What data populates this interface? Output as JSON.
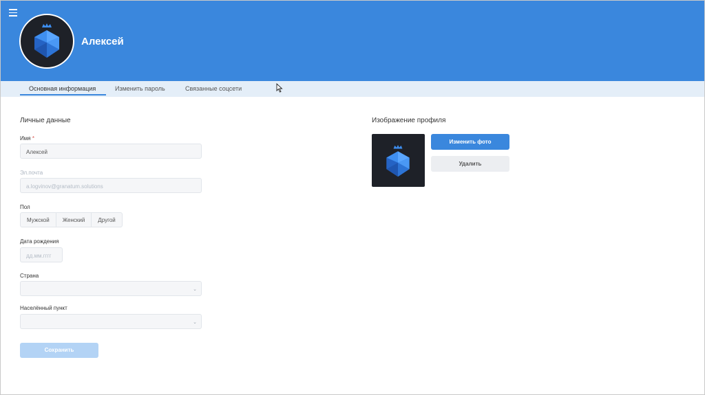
{
  "header": {
    "user_name": "Алексей",
    "background_color": "#3a87dd",
    "menu_icon": "hamburger-menu-icon",
    "avatar_icon": "crowned-gem-icon"
  },
  "tabs": [
    {
      "label": "Основная информация",
      "active": true
    },
    {
      "label": "Изменить пароль",
      "active": false
    },
    {
      "label": "Связанные соцсети",
      "active": false
    }
  ],
  "personal": {
    "section_title": "Личные данные",
    "name_label": "Имя",
    "name_required_mark": "*",
    "name_value": "Алексей",
    "email_label": "Эл.почта",
    "email_value": "a.logvinov@granatum.solutions",
    "gender_label": "Пол",
    "gender_options": [
      "Мужской",
      "Женский",
      "Другой"
    ],
    "birthdate_label": "Дата рождения",
    "birthdate_placeholder": "дд.мм.гггг",
    "country_label": "Страна",
    "country_value": "",
    "city_label": "Населённый пункт",
    "city_value": "",
    "save_label": "Сохранить"
  },
  "profile_image": {
    "section_title": "Изображение профиля",
    "change_label": "Изменить фото",
    "delete_label": "Удалить"
  },
  "colors": {
    "accent": "#3a87dd",
    "save_disabled": "#b3d3f5",
    "tab_bar": "#e4eef8"
  }
}
